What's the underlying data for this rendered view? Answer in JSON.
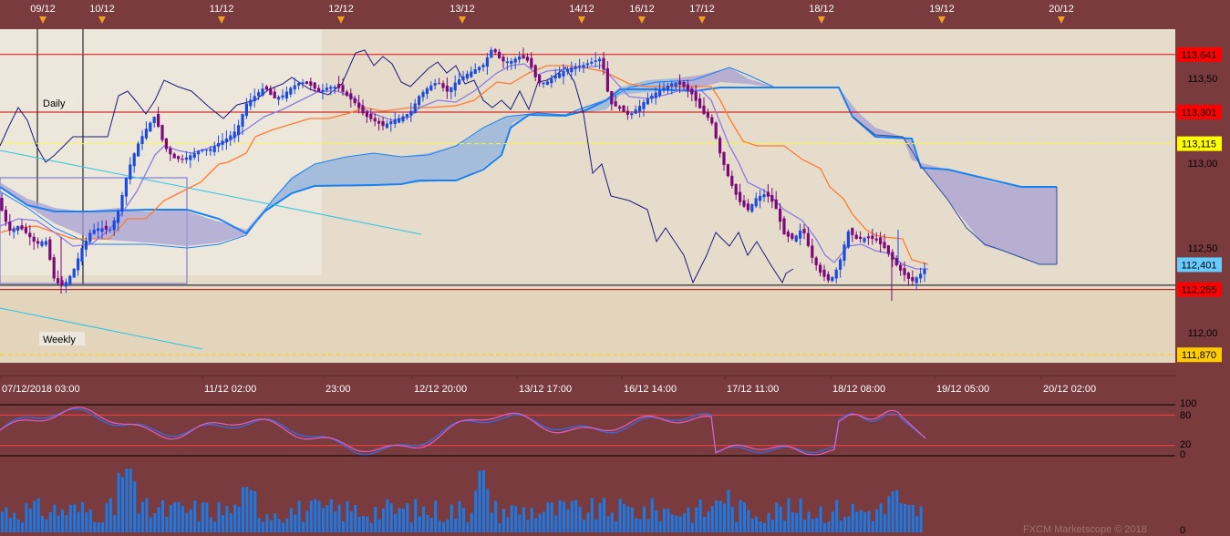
{
  "chart_data": {
    "type": "line",
    "instrument_price_series": "candlestick with Ichimoku cloud, stochastic and volume panels",
    "date_markers": [
      "09/12",
      "10/12",
      "11/12",
      "12/12",
      "13/12",
      "14/12",
      "16/12",
      "17/12",
      "18/12",
      "19/12",
      "20/12"
    ],
    "x_tick_labels": [
      "07/12/2018 03:00",
      "11/12 02:00",
      "23:00",
      "12/12 20:00",
      "13/12 17:00",
      "16/12 14:00",
      "17/12 11:00",
      "18/12 08:00",
      "19/12 05:00",
      "20/12 02:00"
    ],
    "price_ticks": [
      "113,50",
      "113,00",
      "112,50",
      "112,00"
    ],
    "price_range": [
      111.75,
      113.8
    ],
    "level_labels": [
      {
        "text": "113,641",
        "value": 113.641,
        "color": "#ff0000"
      },
      {
        "text": "113,301",
        "value": 113.301,
        "color": "#ff0000"
      },
      {
        "text": "113,115",
        "value": 113.115,
        "color": "#ffff00"
      },
      {
        "text": "112,401",
        "value": 112.401,
        "color": "#66ccff"
      },
      {
        "text": "112,255",
        "value": 112.255,
        "color": "#ff0000"
      },
      {
        "text": "111,870",
        "value": 111.87,
        "color": "#ffcc00"
      }
    ],
    "annotations": [
      "Daily",
      "Weekly"
    ],
    "stochastic_ticks": [
      "100",
      "80",
      "20",
      "0"
    ],
    "volume_ticks": [
      "0"
    ],
    "close_path": [
      [
        0,
        112.75
      ],
      [
        10,
        112.6
      ],
      [
        20,
        112.63
      ],
      [
        30,
        112.58
      ],
      [
        40,
        112.52
      ],
      [
        50,
        112.55
      ],
      [
        60,
        112.3
      ],
      [
        70,
        112.28
      ],
      [
        80,
        112.36
      ],
      [
        90,
        112.5
      ],
      [
        100,
        112.6
      ],
      [
        110,
        112.62
      ],
      [
        120,
        112.6
      ],
      [
        130,
        112.72
      ],
      [
        140,
        112.95
      ],
      [
        150,
        113.1
      ],
      [
        160,
        113.2
      ],
      [
        170,
        113.28
      ],
      [
        180,
        113.1
      ],
      [
        190,
        113.03
      ],
      [
        200,
        113.02
      ],
      [
        210,
        113.05
      ],
      [
        220,
        113.08
      ],
      [
        230,
        113.08
      ],
      [
        240,
        113.12
      ],
      [
        250,
        113.15
      ],
      [
        260,
        113.2
      ],
      [
        270,
        113.35
      ],
      [
        280,
        113.4
      ],
      [
        290,
        113.45
      ],
      [
        300,
        113.38
      ],
      [
        310,
        113.4
      ],
      [
        320,
        113.45
      ],
      [
        330,
        113.48
      ],
      [
        340,
        113.46
      ],
      [
        350,
        113.42
      ],
      [
        360,
        113.45
      ],
      [
        370,
        113.45
      ],
      [
        380,
        113.4
      ],
      [
        390,
        113.35
      ],
      [
        400,
        113.28
      ],
      [
        410,
        113.25
      ],
      [
        420,
        113.22
      ],
      [
        430,
        113.25
      ],
      [
        440,
        113.27
      ],
      [
        450,
        113.3
      ],
      [
        460,
        113.4
      ],
      [
        470,
        113.45
      ],
      [
        480,
        113.48
      ],
      [
        490,
        113.42
      ],
      [
        500,
        113.48
      ],
      [
        510,
        113.52
      ],
      [
        520,
        113.55
      ],
      [
        530,
        113.58
      ],
      [
        540,
        113.68
      ],
      [
        550,
        113.6
      ],
      [
        560,
        113.6
      ],
      [
        570,
        113.63
      ],
      [
        580,
        113.6
      ],
      [
        590,
        113.47
      ],
      [
        600,
        113.48
      ],
      [
        610,
        113.52
      ],
      [
        620,
        113.55
      ],
      [
        630,
        113.57
      ],
      [
        640,
        113.58
      ],
      [
        650,
        113.6
      ],
      [
        660,
        113.62
      ],
      [
        665,
        113.45
      ],
      [
        670,
        113.35
      ],
      [
        680,
        113.32
      ],
      [
        690,
        113.28
      ],
      [
        700,
        113.33
      ],
      [
        710,
        113.38
      ],
      [
        720,
        113.42
      ],
      [
        730,
        113.45
      ],
      [
        740,
        113.48
      ],
      [
        750,
        113.45
      ],
      [
        760,
        113.4
      ],
      [
        770,
        113.3
      ],
      [
        780,
        113.25
      ],
      [
        790,
        113.05
      ],
      [
        800,
        112.9
      ],
      [
        810,
        112.78
      ],
      [
        820,
        112.72
      ],
      [
        830,
        112.8
      ],
      [
        840,
        112.82
      ],
      [
        850,
        112.75
      ],
      [
        860,
        112.58
      ],
      [
        870,
        112.55
      ],
      [
        880,
        112.62
      ],
      [
        890,
        112.45
      ],
      [
        900,
        112.35
      ],
      [
        910,
        112.3
      ],
      [
        920,
        112.4
      ],
      [
        930,
        112.6
      ],
      [
        940,
        112.55
      ],
      [
        950,
        112.56
      ],
      [
        960,
        112.55
      ],
      [
        970,
        112.5
      ],
      [
        980,
        112.42
      ],
      [
        990,
        112.35
      ],
      [
        1000,
        112.3
      ],
      [
        1010,
        112.35
      ],
      [
        1018,
        112.4
      ]
    ],
    "horizontal_lines": [
      {
        "value": 113.641,
        "color": "#ff0000"
      },
      {
        "value": 113.301,
        "color": "#cc0000"
      },
      {
        "value": 113.115,
        "color": "#ffff00",
        "style": "dashed"
      },
      {
        "value": 112.28,
        "color": "#000000"
      },
      {
        "value": 112.255,
        "color": "#cc0000"
      },
      {
        "value": 111.87,
        "color": "#ffcc00",
        "style": "dashed"
      }
    ],
    "grid": false
  },
  "watermark": "FXCM Marketscope © 2018"
}
